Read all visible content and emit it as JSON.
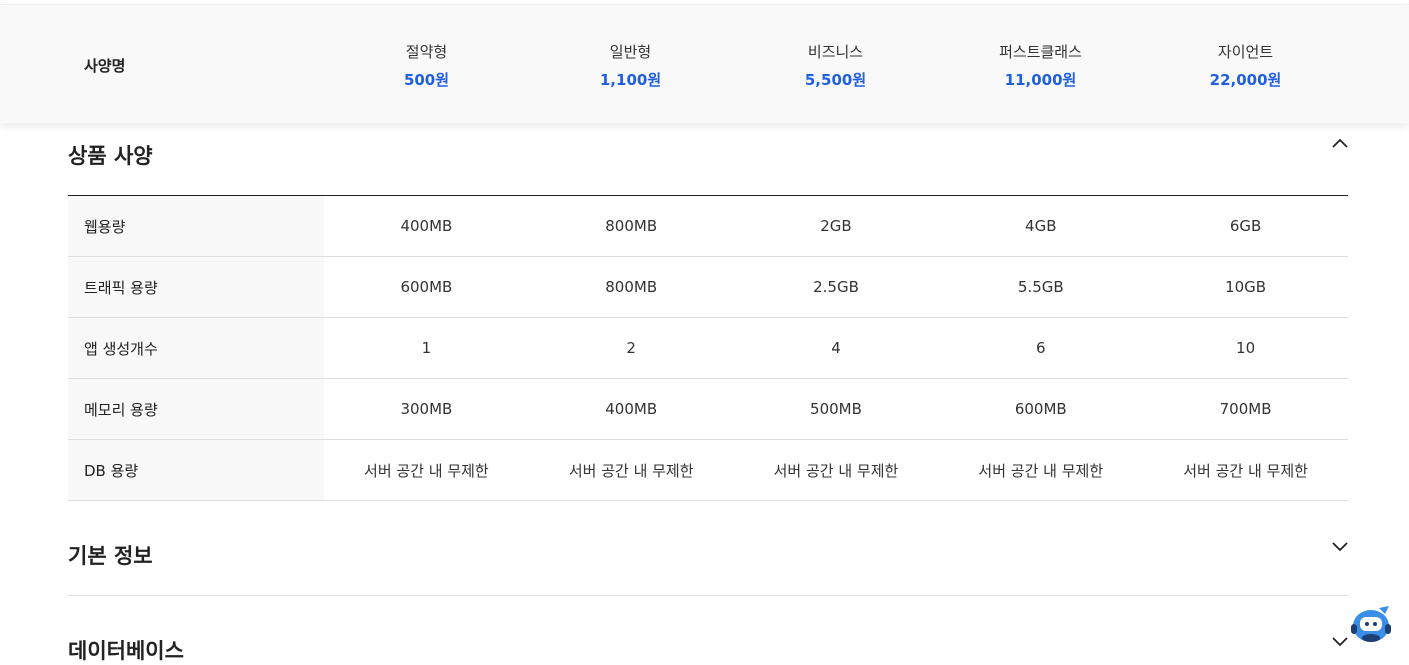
{
  "header": {
    "spec_label": "사양명",
    "plans": [
      {
        "name": "절약형",
        "price": "500원"
      },
      {
        "name": "일반형",
        "price": "1,100원"
      },
      {
        "name": "비즈니스",
        "price": "5,500원"
      },
      {
        "name": "퍼스트클래스",
        "price": "11,000원"
      },
      {
        "name": "자이언트",
        "price": "22,000원"
      }
    ]
  },
  "sections": {
    "product_spec": {
      "title": "상품 사양",
      "expanded": true
    },
    "basic_info": {
      "title": "기본 정보",
      "expanded": false
    },
    "database": {
      "title": "데이터베이스",
      "expanded": false
    }
  },
  "spec_rows": [
    {
      "label": "웹용량",
      "values": [
        "400MB",
        "800MB",
        "2GB",
        "4GB",
        "6GB"
      ]
    },
    {
      "label": "트래픽 용량",
      "values": [
        "600MB",
        "800MB",
        "2.5GB",
        "5.5GB",
        "10GB"
      ]
    },
    {
      "label": "앱 생성개수",
      "values": [
        "1",
        "2",
        "4",
        "6",
        "10"
      ]
    },
    {
      "label": "메모리 용량",
      "values": [
        "300MB",
        "400MB",
        "500MB",
        "600MB",
        "700MB"
      ]
    },
    {
      "label": "DB 용량",
      "values": [
        "서버 공간 내 무제한",
        "서버 공간 내 무제한",
        "서버 공간 내 무제한",
        "서버 공간 내 무제한",
        "서버 공간 내 무제한"
      ]
    }
  ],
  "icons": {
    "collapse": "chevron-up-icon",
    "expand": "chevron-down-icon",
    "chat": "chatbot-icon"
  },
  "colors": {
    "price_accent": "#1f5fe0",
    "label_bg": "#f8f8f8",
    "header_bg": "#f9f9f9",
    "chat_blue": "#3b8ee8"
  }
}
